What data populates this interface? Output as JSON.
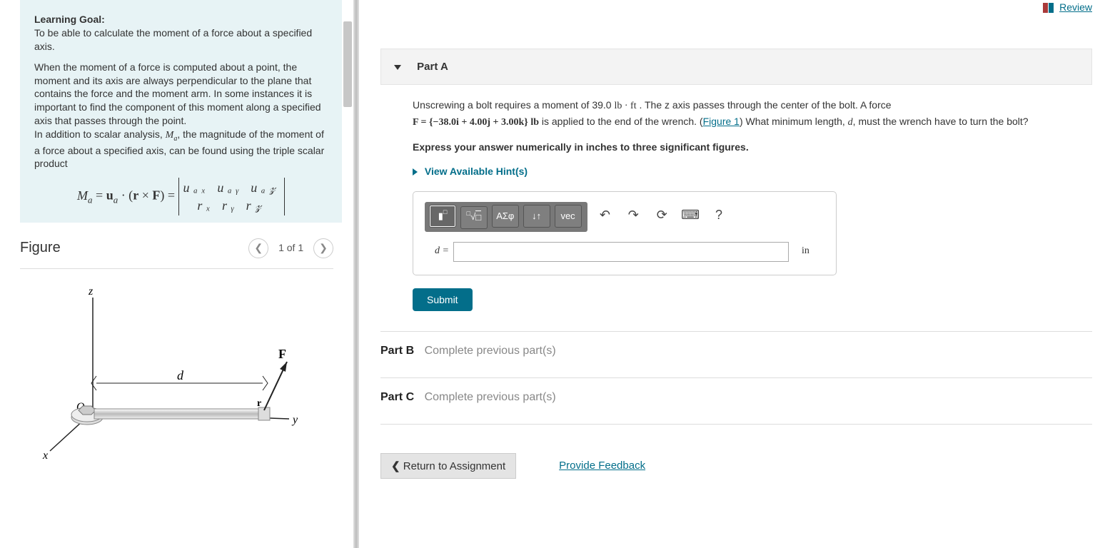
{
  "left": {
    "heading": "Learning Goal:",
    "goal": "To be able to calculate the moment of a force about a specified axis.",
    "para1": "When the moment of a force is computed about a point, the moment and its axis are always perpendicular to the plane that contains the force and the moment arm. In some instances it is important to find the component of this moment along a specified axis that passes through the point.",
    "para2a": "In addition to scalar analysis, ",
    "para2_sym": "M",
    "para2_sub": "a",
    "para2b": ", the magnitude of the moment of a force about a specified axis, can be found using the triple scalar product",
    "mrow1": "uₐₓ  uₐᵧ  uₐ𝓏",
    "mrow2": "rₓ  rᵧ  r𝓏",
    "figure_title": "Figure",
    "pager": "1 of 1",
    "fig": {
      "z": "z",
      "F": "F",
      "d": "d",
      "r": "r",
      "y": "y",
      "x": "x",
      "O": "O"
    }
  },
  "right": {
    "review": "Review",
    "partA_label": "Part A",
    "q1a": "Unscrewing a bolt requires a moment of 39.0 ",
    "q1_unit1": "lb · ft",
    "q1b": " . The z axis passes through the center of the bolt. A force ",
    "force_eq": "F = {−38.0i + 4.00j + 3.00k} lb",
    "q1c": " is applied to the end of the wrench. (",
    "fig_link": "Figure 1",
    "q1d": ") What minimum length, ",
    "q1_var": "d",
    "q1e": ", must the wrench have to turn the bolt?",
    "instr": "Express your answer numerically in inches to three significant figures.",
    "hints": "View Available Hint(s)",
    "tb_greek": "ΑΣφ",
    "tb_vec": "vec",
    "lhs": "d =",
    "unit": "in",
    "submit": "Submit",
    "partB_label": "Part B",
    "partB_msg": "Complete previous part(s)",
    "partC_label": "Part C",
    "partC_msg": "Complete previous part(s)",
    "return": "Return to Assignment",
    "feedback": "Provide Feedback"
  }
}
